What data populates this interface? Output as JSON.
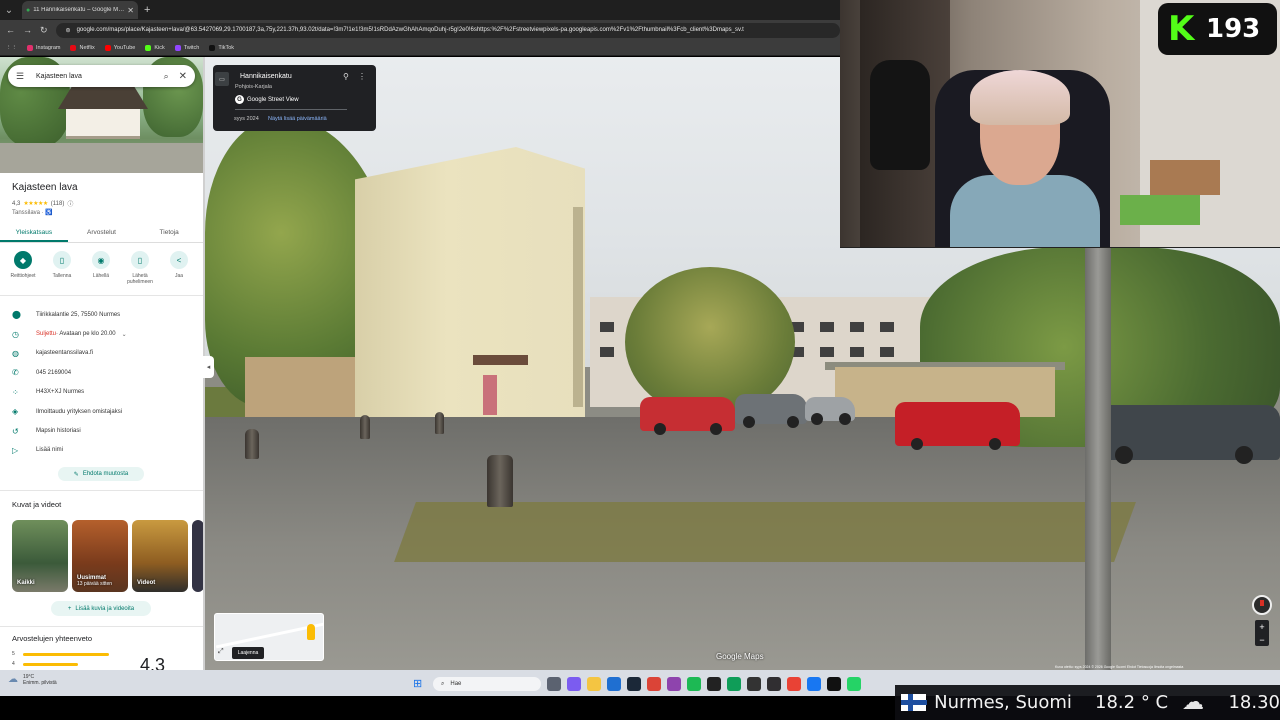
{
  "browser": {
    "tab_title": "11 Hannikaisenkatu – Google Maps",
    "url": "google.com/maps/place/Kajasteen+lava/@63.5427069,29.1700187,3a,75y,221.37h,93.02t/data=!3m7!1e1!3m5!1sRDdAzwGhAhAmqoDuhj-r5g!2e0!6shttps:%2F%2Fstreetviewpixels-pa.googleapis.com%2Fv1%2Fthumbnail%3Fcb_client%3Dmaps_sv.t",
    "bookmarks": [
      {
        "label": "Instagram",
        "color": "#e1306c"
      },
      {
        "label": "Netflix",
        "color": "#e50914"
      },
      {
        "label": "YouTube",
        "color": "#ff0000"
      },
      {
        "label": "Kick",
        "color": "#53fc18"
      },
      {
        "label": "Twitch",
        "color": "#9146ff"
      },
      {
        "label": "TikTok",
        "color": "#111111"
      }
    ]
  },
  "search": {
    "value": "Kajasteen lava"
  },
  "place": {
    "name": "Kajasteen lava",
    "rating": "4,3",
    "stars": "★★★★★",
    "reviews": "(118)",
    "category": "Tanssilava ·",
    "tabs": [
      "Yleiskatsaus",
      "Arvostelut",
      "Tietoja"
    ],
    "actions": [
      {
        "label": "Reittiohjeet",
        "icon": "◆"
      },
      {
        "label": "Tallenna",
        "icon": "▯"
      },
      {
        "label": "Lähellä",
        "icon": "◉"
      },
      {
        "label": "Lähetä puhelimeen",
        "icon": "▯"
      },
      {
        "label": "Jaa",
        "icon": "<"
      }
    ],
    "address": "Tiirikkalantie 25, 75500 Nurmes",
    "status_closed": "Suljettu",
    "status_open": " · Avataan pe klo 20.00",
    "website": "kajasteentanssilava.fi",
    "phone": "045 2169004",
    "plus_code": "H43X+XJ Nurmes",
    "claim": "Ilmoittaudu yrityksen omistajaksi",
    "history": "Mapsin historiasi",
    "add_label": "Lisää nimi",
    "suggest_edit": "Ehdota muutosta",
    "photos_title": "Kuvat ja videot",
    "photos": [
      {
        "label": "Kaikki",
        "sub": ""
      },
      {
        "label": "Uusimmat",
        "sub": "13 päivää sitten"
      },
      {
        "label": "Videot",
        "sub": ""
      }
    ],
    "add_photos": "Lisää kuvia ja videoita",
    "review_summary_title": "Arvostelujen yhteenveto",
    "review_bars": [
      {
        "star": "5",
        "share": 0.78
      },
      {
        "star": "4",
        "share": 0.5
      }
    ],
    "big_rating": "4.3"
  },
  "streetview": {
    "street": "Hannikaisenkatu",
    "region": "Pohjois-Karjala",
    "provider": "Google Street View",
    "date": "syys 2024",
    "more_dates": "Näytä lisää päivämääriä",
    "expand": "Laajenna",
    "watermark": "Google Maps",
    "footer": "Kuva otettu: syys 2024   © 2026 Google   Suomi   Ehdot   Tietosuoja   Ilmoita ongelmasta"
  },
  "stream": {
    "kick_logo": "K",
    "viewer_count": "193",
    "location": "Nurmes, Suomi",
    "temperature": "18.2 ° C",
    "time": "18.30"
  },
  "taskbar": {
    "weather_temp": "19°C",
    "weather_desc": "Enimm. pilvistä",
    "search_placeholder": "Hae",
    "icons": [
      {
        "name": "task-view-icon",
        "color": "#5b6270"
      },
      {
        "name": "copilot-icon",
        "color": "#7b5cf0"
      },
      {
        "name": "file-explorer-icon",
        "color": "#f4c542"
      },
      {
        "name": "mail-icon",
        "color": "#1f6fd1"
      },
      {
        "name": "steam-icon",
        "color": "#1b2838"
      },
      {
        "name": "chrome-icon",
        "color": "#db4437"
      },
      {
        "name": "vpn-icon",
        "color": "#8e44ad"
      },
      {
        "name": "spotify-icon",
        "color": "#1db954"
      },
      {
        "name": "media-icon",
        "color": "#222222"
      },
      {
        "name": "app-icon",
        "color": "#0f9d58"
      },
      {
        "name": "tool-icon",
        "color": "#333333"
      },
      {
        "name": "obs-icon",
        "color": "#302e31"
      },
      {
        "name": "browser-icon",
        "color": "#e94235"
      },
      {
        "name": "messenger-icon",
        "color": "#1877f2"
      },
      {
        "name": "capcut-icon",
        "color": "#111111"
      },
      {
        "name": "whatsapp-icon",
        "color": "#25d366"
      }
    ]
  }
}
